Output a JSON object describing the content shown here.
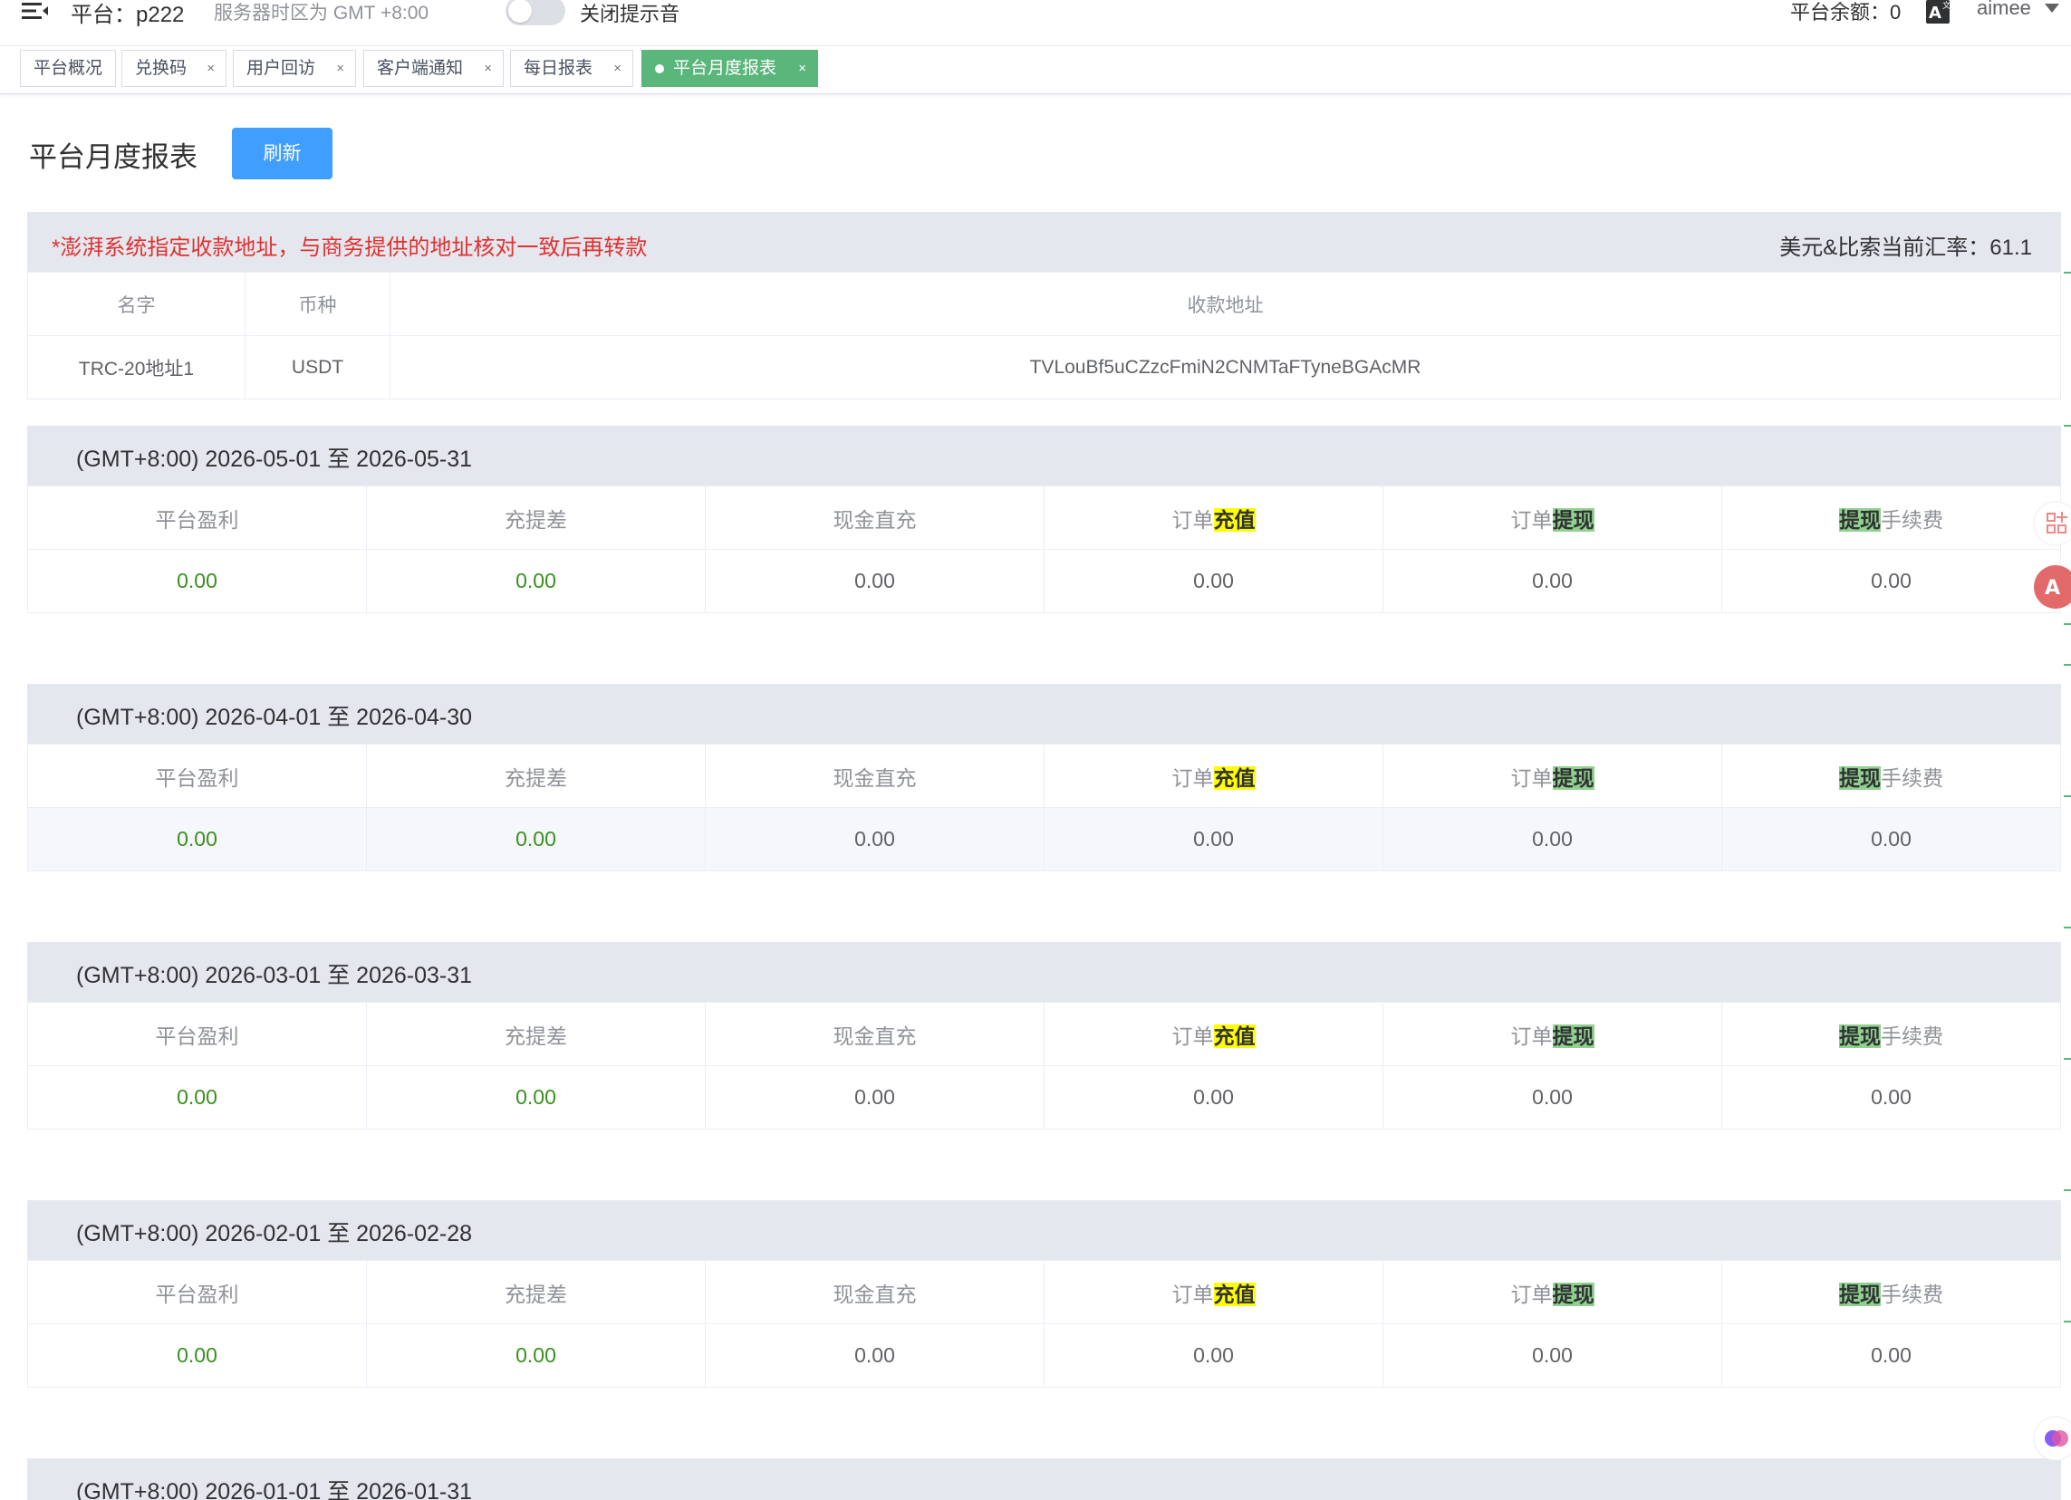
{
  "topbar": {
    "platform": "平台：p222",
    "server_tz": "服务器时区为 GMT +8:00",
    "sound_toggle_label": "关闭提示音",
    "balance": "平台余额：0",
    "user": "aimee",
    "icons": {
      "menu": "menu-fold-icon",
      "language": "translate-icon",
      "dropdown": "caret-down-icon"
    }
  },
  "tabs": [
    {
      "label": "平台概况",
      "closable": false
    },
    {
      "label": "兑换码",
      "closable": true
    },
    {
      "label": "用户回访",
      "closable": true
    },
    {
      "label": "客户端通知",
      "closable": true
    },
    {
      "label": "每日报表",
      "closable": true
    },
    {
      "label": "平台月度报表",
      "closable": true,
      "active": true
    }
  ],
  "page": {
    "title": "平台月度报表",
    "refresh_label": "刷新"
  },
  "address": {
    "notice": "*澎湃系统指定收款地址，与商务提供的地址核对一致后再转款",
    "rate": "美元&比索当前汇率：61.1",
    "headers": [
      "名字",
      "币种",
      "收款地址"
    ],
    "rows": [
      {
        "name": "TRC-20地址1",
        "currency": "USDT",
        "address": "TVLouBf5uCZzcFmiN2CNMTaFTyneBGAcMR"
      }
    ]
  },
  "columns": {
    "platform_profit": "平台盈利",
    "deposit_diff": "充提差",
    "cash_deposit": "现金直充",
    "order_prefix": "订单",
    "deposit": "充值",
    "withdraw": "提现",
    "fee_suffix": "手续费"
  },
  "months": [
    {
      "range": "(GMT+8:00) 2026-05-01 至 2026-05-31",
      "values": [
        "0.00",
        "0.00",
        "0.00",
        "0.00",
        "0.00",
        "0.00"
      ]
    },
    {
      "range": "(GMT+8:00) 2026-04-01 至 2026-04-30",
      "values": [
        "0.00",
        "0.00",
        "0.00",
        "0.00",
        "0.00",
        "0.00"
      ]
    },
    {
      "range": "(GMT+8:00) 2026-03-01 至 2026-03-31",
      "values": [
        "0.00",
        "0.00",
        "0.00",
        "0.00",
        "0.00",
        "0.00"
      ]
    },
    {
      "range": "(GMT+8:00) 2026-02-01 至 2026-02-28",
      "values": [
        "0.00",
        "0.00",
        "0.00",
        "0.00",
        "0.00",
        "0.00"
      ]
    },
    {
      "range": "(GMT+8:00) 2026-01-01 至 2026-01-31"
    }
  ],
  "colors": {
    "primary": "#409eff",
    "active_tab": "#5bb67c",
    "notice_red": "#e03131",
    "value_green": "#3a8f1e",
    "highlight_yellow": "#ffff00",
    "highlight_green": "#8fd18f"
  }
}
